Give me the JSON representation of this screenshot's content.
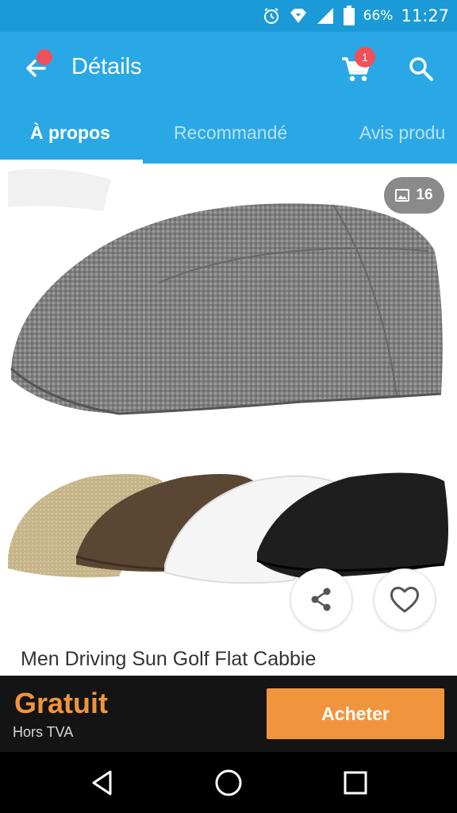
{
  "status_bar": {
    "battery": "66%",
    "time": "11:27",
    "icons": [
      "alarm-icon",
      "vpn-icon",
      "signal-icon",
      "battery-icon"
    ]
  },
  "app_bar": {
    "title": "Détails",
    "cart_badge": "1",
    "icons": [
      "back-arrow-icon",
      "cart-icon",
      "search-icon"
    ]
  },
  "tabs": [
    {
      "label": "À propos",
      "active": true
    },
    {
      "label": "Recommandé",
      "active": false
    },
    {
      "label": "Avis produ",
      "active": false
    }
  ],
  "gallery": {
    "image_count": "16",
    "subject": "flat cabbie caps: grey, beige, brown, white, black"
  },
  "product": {
    "title": "Men Driving Sun Golf Flat Cabbie"
  },
  "purchase": {
    "price": "Gratuit",
    "tax_note": "Hors TVA",
    "button_label": "Acheter"
  },
  "colors": {
    "status_bar": "#1a9ad6",
    "app_bar": "#2aa8e5",
    "accent_orange": "#f0953e",
    "badge_red": "#f0505a",
    "buy_bar": "#141414"
  }
}
